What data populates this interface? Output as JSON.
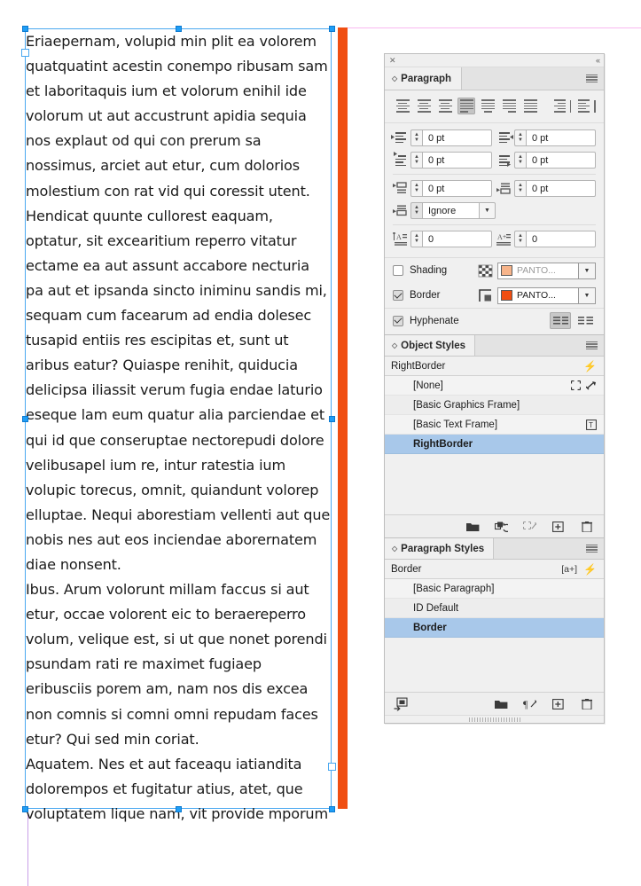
{
  "document": {
    "frame_text": "Eriaepernam, volupid min plit ea volorem quatquatint acestin conempo ribusam sam et laboritaquis ium et volorum enihil ide volorum ut aut accustrunt apidia sequia nos explaut od qui con prerum sa nossimus, arciet aut etur, cum dolorios molestium con rat vid qui coressit utent. Hendicat quunte cullorest eaquam, optatur, sit excearitium reperro vitatur ectame ea aut assunt accabore necturia pa aut et ipsanda sincto iniminu sandis mi, sequam cum facearum ad endia dolesec tusapid entiis res escipitas et, sunt ut aribus eatur? Quiaspe renihit, quiducia delicipsa iliassit verum fugia endae laturio eseque lam eum quatur alia parciendae et qui id que conseruptae nectorepudi dolore velibusapel ium re, intur ratestia ium volupic torecus, omnit, quiandunt volorep elluptae. Nequi aborestiam vellenti aut que nobis nes aut eos inciendae aborernatem diae nonsent.\nIbus. Arum volorunt millam faccus si aut etur, occae volorent eic to beraereperro volum, velique est, si ut que nonet porendi psundam rati re maximet fugiaep eribusciis porem am, nam nos dis excea non comnis si comni omni repudam faces etur? Qui sed min coriat.\nAquatem. Nes et aut faceaqu iatiandita dolorempos et fugitatur atius, atet, que voluptatem lique nam, vit provide mporum",
    "border_color": "#f04e11",
    "selection_color": "#1f9df5",
    "guide_color": "#f9b9f0"
  },
  "panel_window": {
    "close_label": "✕",
    "collapse_label": "«"
  },
  "paragraph_panel": {
    "tab_label": "Paragraph",
    "align_buttons": [
      {
        "name": "align-left",
        "selected": false
      },
      {
        "name": "align-center",
        "selected": false
      },
      {
        "name": "align-right",
        "selected": false
      },
      {
        "name": "justify-with-last-line-left",
        "selected": true
      },
      {
        "name": "justify-with-last-line-center",
        "selected": false
      },
      {
        "name": "justify-with-last-line-right",
        "selected": false
      },
      {
        "name": "justify-all-lines",
        "selected": false
      },
      {
        "name": "align-towards-spine",
        "selected": false
      },
      {
        "name": "align-away-from-spine",
        "selected": false
      }
    ],
    "fields": {
      "left_indent": "0 pt",
      "right_indent": "0 pt",
      "first_line_left_indent": "0 pt",
      "last_line_right_indent": "0 pt",
      "space_before": "0 pt",
      "space_after": "0 pt",
      "align_to_grid": "Ignore",
      "drop_cap_lines": "0",
      "drop_cap_chars": "0"
    },
    "shading": {
      "label": "Shading",
      "checked": false,
      "swatch_label": "PANTO...",
      "swatch_color": "#f7b48a"
    },
    "border": {
      "label": "Border",
      "checked": true,
      "swatch_label": "PANTO...",
      "swatch_color": "#f04e11"
    },
    "hyphenate": {
      "label": "Hyphenate",
      "checked": true,
      "composer_buttons": [
        {
          "name": "paragraph-composer",
          "selected": true
        },
        {
          "name": "single-line-composer",
          "selected": false
        }
      ]
    }
  },
  "object_styles_panel": {
    "tab_label": "Object Styles",
    "current_style": "RightBorder",
    "items": [
      {
        "label": "[None]",
        "selected": false,
        "icons": [
          "none-frame-icon",
          "break-link-icon"
        ]
      },
      {
        "label": "[Basic Graphics Frame]",
        "selected": false,
        "icons": []
      },
      {
        "label": "[Basic Text Frame]",
        "selected": false,
        "icons": [
          "text-frame-icon"
        ]
      },
      {
        "label": "RightBorder",
        "selected": true,
        "icons": []
      }
    ],
    "footer_icons": [
      "new-group-icon",
      "clear-overrides-icon",
      "clear-attributes-icon",
      "new-style-icon",
      "delete-style-icon"
    ]
  },
  "paragraph_styles_panel": {
    "tab_label": "Paragraph Styles",
    "current_style": "Border",
    "current_style_badge": "[a+]",
    "items": [
      {
        "label": "[Basic Paragraph]",
        "selected": false
      },
      {
        "label": "ID Default",
        "selected": false
      },
      {
        "label": "Border",
        "selected": true
      }
    ],
    "footer_icons": [
      "load-styles-icon",
      "new-group-icon",
      "clear-overrides-icon",
      "new-style-icon",
      "delete-style-icon"
    ]
  }
}
